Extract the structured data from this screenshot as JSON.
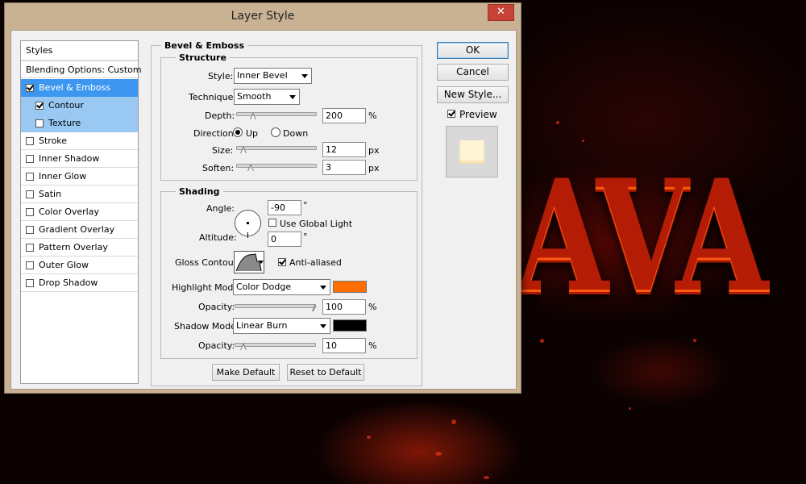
{
  "dialog": {
    "title": "Layer Style",
    "close_glyph": "✕"
  },
  "styles_list": {
    "header": "Styles",
    "blending": "Blending Options: Custom",
    "items": [
      {
        "label": "Bevel & Emboss",
        "checked": true
      },
      {
        "label": "Contour",
        "checked": true
      },
      {
        "label": "Texture",
        "checked": false
      },
      {
        "label": "Stroke",
        "checked": false
      },
      {
        "label": "Inner Shadow",
        "checked": false
      },
      {
        "label": "Inner Glow",
        "checked": false
      },
      {
        "label": "Satin",
        "checked": false
      },
      {
        "label": "Color Overlay",
        "checked": false
      },
      {
        "label": "Gradient Overlay",
        "checked": false
      },
      {
        "label": "Pattern Overlay",
        "checked": false
      },
      {
        "label": "Outer Glow",
        "checked": false
      },
      {
        "label": "Drop Shadow",
        "checked": false
      }
    ]
  },
  "bevel": {
    "title": "Bevel & Emboss",
    "structure": {
      "title": "Structure",
      "style_label": "Style:",
      "style_value": "Inner Bevel",
      "technique_label": "Technique:",
      "technique_value": "Smooth",
      "depth_label": "Depth:",
      "depth_value": "200",
      "depth_unit": "%",
      "depth_slider_fraction": 0.2,
      "direction_label": "Direction:",
      "direction_up": "Up",
      "direction_down": "Down",
      "direction_selected": "Up",
      "size_label": "Size:",
      "size_value": "12",
      "size_unit": "px",
      "size_slider_fraction": 0.08,
      "soften_label": "Soften:",
      "soften_value": "3",
      "soften_unit": "px",
      "soften_slider_fraction": 0.17
    },
    "shading": {
      "title": "Shading",
      "angle_label": "Angle:",
      "angle_value": "-90",
      "angle_unit": "°",
      "use_global_light": "Use Global Light",
      "use_global_light_checked": false,
      "altitude_label": "Altitude:",
      "altitude_value": "0",
      "altitude_unit": "°",
      "gloss_contour_label": "Gloss Contour:",
      "anti_aliased": "Anti-aliased",
      "anti_aliased_checked": true,
      "highlight_mode_label": "Highlight Mode:",
      "highlight_mode_value": "Color Dodge",
      "highlight_color": "#ff6d00",
      "highlight_opacity_label": "Opacity:",
      "highlight_opacity_value": "100",
      "highlight_opacity_unit": "%",
      "highlight_opacity_fraction": 1.0,
      "shadow_mode_label": "Shadow Mode:",
      "shadow_mode_value": "Linear Burn",
      "shadow_color": "#000000",
      "shadow_opacity_label": "Opacity:",
      "shadow_opacity_value": "10",
      "shadow_opacity_unit": "%",
      "shadow_opacity_fraction": 0.1
    },
    "make_default": "Make Default",
    "reset_default": "Reset to Default"
  },
  "actions": {
    "ok": "OK",
    "cancel": "Cancel",
    "new_style": "New Style...",
    "preview_label": "Preview",
    "preview_checked": true
  },
  "background": {
    "word": "AVA",
    "accent": "#b41c05"
  }
}
